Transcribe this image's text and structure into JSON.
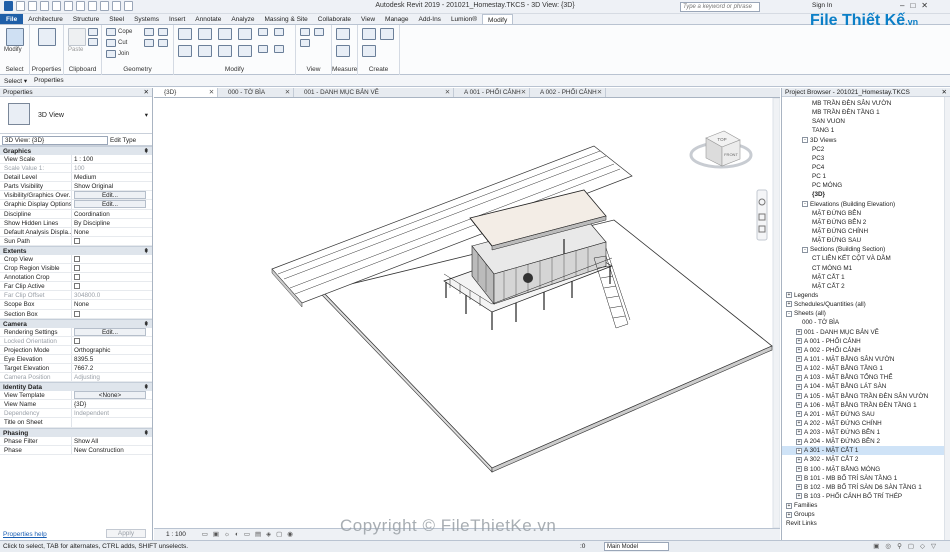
{
  "titlebar": {
    "title": "Autodesk Revit 2019 - 201021_Homestay.TKCS - 3D View: {3D}",
    "search_placeholder": "Type a keyword or phrase",
    "sign_in": "Sign In"
  },
  "logo": {
    "main": "File Thiết Kế",
    "suffix": ".vn"
  },
  "tabs": [
    "File",
    "Architecture",
    "Structure",
    "Steel",
    "Systems",
    "Insert",
    "Annotate",
    "Analyze",
    "Massing & Site",
    "Collaborate",
    "View",
    "Manage",
    "Add-Ins",
    "Lumion®",
    "Modify"
  ],
  "active_tab": "Modify",
  "ribbon": {
    "groups": [
      "Select",
      "Properties",
      "Clipboard",
      "Geometry",
      "Modify",
      "View",
      "Measure",
      "Create"
    ],
    "modify_label": "Modify",
    "paste_label": "Paste",
    "cope_label": "Cope",
    "cut_label": "Cut",
    "join_label": "Join"
  },
  "options": {
    "select_label": "Select ▾",
    "properties_label": "Properties"
  },
  "properties": {
    "header": "Properties",
    "type_name": "3D View",
    "view_selector": "3D View: {3D}",
    "edit_type": "Edit Type",
    "groups": [
      {
        "name": "Graphics",
        "rows": [
          [
            "View Scale",
            "1 : 100"
          ],
          [
            "Scale Value    1:",
            "100"
          ],
          [
            "Detail Level",
            "Medium"
          ],
          [
            "Parts Visibility",
            "Show Original"
          ],
          [
            "Visibility/Graphics Over...",
            "Edit..."
          ],
          [
            "Graphic Display Options",
            "Edit..."
          ],
          [
            "Discipline",
            "Coordination"
          ],
          [
            "Show Hidden Lines",
            "By Discipline"
          ],
          [
            "Default Analysis Displa...",
            "None"
          ],
          [
            "Sun Path",
            ""
          ]
        ]
      },
      {
        "name": "Extents",
        "rows": [
          [
            "Crop View",
            ""
          ],
          [
            "Crop Region Visible",
            ""
          ],
          [
            "Annotation Crop",
            ""
          ],
          [
            "Far Clip Active",
            ""
          ],
          [
            "Far Clip Offset",
            "304800.0"
          ],
          [
            "Scope Box",
            "None"
          ],
          [
            "Section Box",
            ""
          ]
        ]
      },
      {
        "name": "Camera",
        "rows": [
          [
            "Rendering Settings",
            "Edit..."
          ],
          [
            "Locked Orientation",
            ""
          ],
          [
            "Projection Mode",
            "Orthographic"
          ],
          [
            "Eye Elevation",
            "8395.5"
          ],
          [
            "Target Elevation",
            "7667.2"
          ],
          [
            "Camera Position",
            "Adjusting"
          ]
        ]
      },
      {
        "name": "Identity Data",
        "rows": [
          [
            "View Template",
            "<None>"
          ],
          [
            "View Name",
            "{3D}"
          ],
          [
            "Dependency",
            "Independent"
          ],
          [
            "Title on Sheet",
            ""
          ]
        ]
      },
      {
        "name": "Phasing",
        "rows": [
          [
            "Phase Filter",
            "Show All"
          ],
          [
            "Phase",
            "New Construction"
          ]
        ]
      }
    ],
    "help": "Properties help",
    "apply": "Apply"
  },
  "view_tabs": [
    "{3D}",
    "000 - TỜ BÌA",
    "001 - DANH MỤC BẢN VẼ",
    "A 001 - PHỐI CẢNH",
    "A 002 - PHỐI CẢNH"
  ],
  "viewcube": {
    "top": "TOP",
    "front": "FRONT"
  },
  "view_scale": "1 : 100",
  "browser": {
    "header": "Project Browser - 201021_Homestay.TKCS",
    "items": [
      {
        "t": "MB TRẦN ĐÈN SÂN VƯỜN",
        "i": 30
      },
      {
        "t": "MB TRẦN ĐÈN TẦNG 1",
        "i": 30
      },
      {
        "t": "SAN VUON",
        "i": 30
      },
      {
        "t": "TANG 1",
        "i": 30
      },
      {
        "t": "3D Views",
        "i": 20,
        "g": "-"
      },
      {
        "t": "PC2",
        "i": 30
      },
      {
        "t": "PC3",
        "i": 30
      },
      {
        "t": "PC4",
        "i": 30
      },
      {
        "t": "PC 1",
        "i": 30
      },
      {
        "t": "PC MÓNG",
        "i": 30
      },
      {
        "t": "{3D}",
        "i": 30,
        "b": true
      },
      {
        "t": "Elevations (Building Elevation)",
        "i": 20,
        "g": "-"
      },
      {
        "t": "MẶT ĐỨNG BÊN",
        "i": 30
      },
      {
        "t": "MẶT ĐỨNG BÊN 2",
        "i": 30
      },
      {
        "t": "MẶT ĐỨNG CHÍNH",
        "i": 30
      },
      {
        "t": "MẶT ĐỨNG SAU",
        "i": 30
      },
      {
        "t": "Sections (Building Section)",
        "i": 20,
        "g": "-"
      },
      {
        "t": "CT LIÊN KẾT CỘT VÀ DẦM",
        "i": 30
      },
      {
        "t": "CT MÓNG M1",
        "i": 30
      },
      {
        "t": "MẶT CẮT 1",
        "i": 30
      },
      {
        "t": "MẶT CẮT 2",
        "i": 30
      },
      {
        "t": "Legends",
        "i": 4,
        "g": "+"
      },
      {
        "t": "Schedules/Quantities (all)",
        "i": 4,
        "g": "+"
      },
      {
        "t": "Sheets (all)",
        "i": 4,
        "g": "-"
      },
      {
        "t": "000 - TỜ BÌA",
        "i": 20
      },
      {
        "t": "001 - DANH MỤC BẢN VẼ",
        "i": 14,
        "g": "+"
      },
      {
        "t": "A 001 - PHỐI CẢNH",
        "i": 14,
        "g": "+"
      },
      {
        "t": "A 002 - PHỐI CẢNH",
        "i": 14,
        "g": "+"
      },
      {
        "t": "A 101 - MẶT BẰNG SÂN VƯỜN",
        "i": 14,
        "g": "+"
      },
      {
        "t": "A 102 - MẶT BẰNG TẦNG 1",
        "i": 14,
        "g": "+"
      },
      {
        "t": "A 103 - MẶT BẰNG TỔNG THỂ",
        "i": 14,
        "g": "+"
      },
      {
        "t": "A 104 - MẶT BẰNG LÁT SÀN",
        "i": 14,
        "g": "+"
      },
      {
        "t": "A 105 - MẶT BẰNG TRẦN ĐÈN SÂN VƯỜN",
        "i": 14,
        "g": "+"
      },
      {
        "t": "A 106 - MẶT BẰNG TRẦN ĐÈN TẦNG 1",
        "i": 14,
        "g": "+"
      },
      {
        "t": "A 201 - MẶT ĐỨNG SAU",
        "i": 14,
        "g": "+"
      },
      {
        "t": "A 202 - MẶT ĐỨNG CHÍNH",
        "i": 14,
        "g": "+"
      },
      {
        "t": "A 203 - MẶT ĐỨNG BÊN 1",
        "i": 14,
        "g": "+"
      },
      {
        "t": "A 204 - MẶT ĐỨNG BÊN 2",
        "i": 14,
        "g": "+"
      },
      {
        "t": "A 301 - MẶT CẮT 1",
        "i": 14,
        "g": "+",
        "s": true
      },
      {
        "t": "A 302 - MẶT CẮT 2",
        "i": 14,
        "g": "+"
      },
      {
        "t": "B 100 - MẶT BẰNG MÓNG",
        "i": 14,
        "g": "+"
      },
      {
        "t": "B 101 - MB BỐ TRÍ SÀN TẦNG 1",
        "i": 14,
        "g": "+"
      },
      {
        "t": "B 102 - MB BỐ TRÍ SÀN D6 SÀN TẦNG 1",
        "i": 14,
        "g": "+"
      },
      {
        "t": "B 103 - PHỐI CẢNH BỐ TRÍ THÉP",
        "i": 14,
        "g": "+"
      },
      {
        "t": "Families",
        "i": 4,
        "g": "+"
      },
      {
        "t": "Groups",
        "i": 4,
        "g": "+"
      },
      {
        "t": "Revit Links",
        "i": 4
      }
    ]
  },
  "status": {
    "text": "Click to select, TAB for alternates, CTRL adds, SHIFT unselects.",
    "model": "Main Model",
    "zero": ":0"
  },
  "watermark": "Copyright © FileThietKe.vn"
}
